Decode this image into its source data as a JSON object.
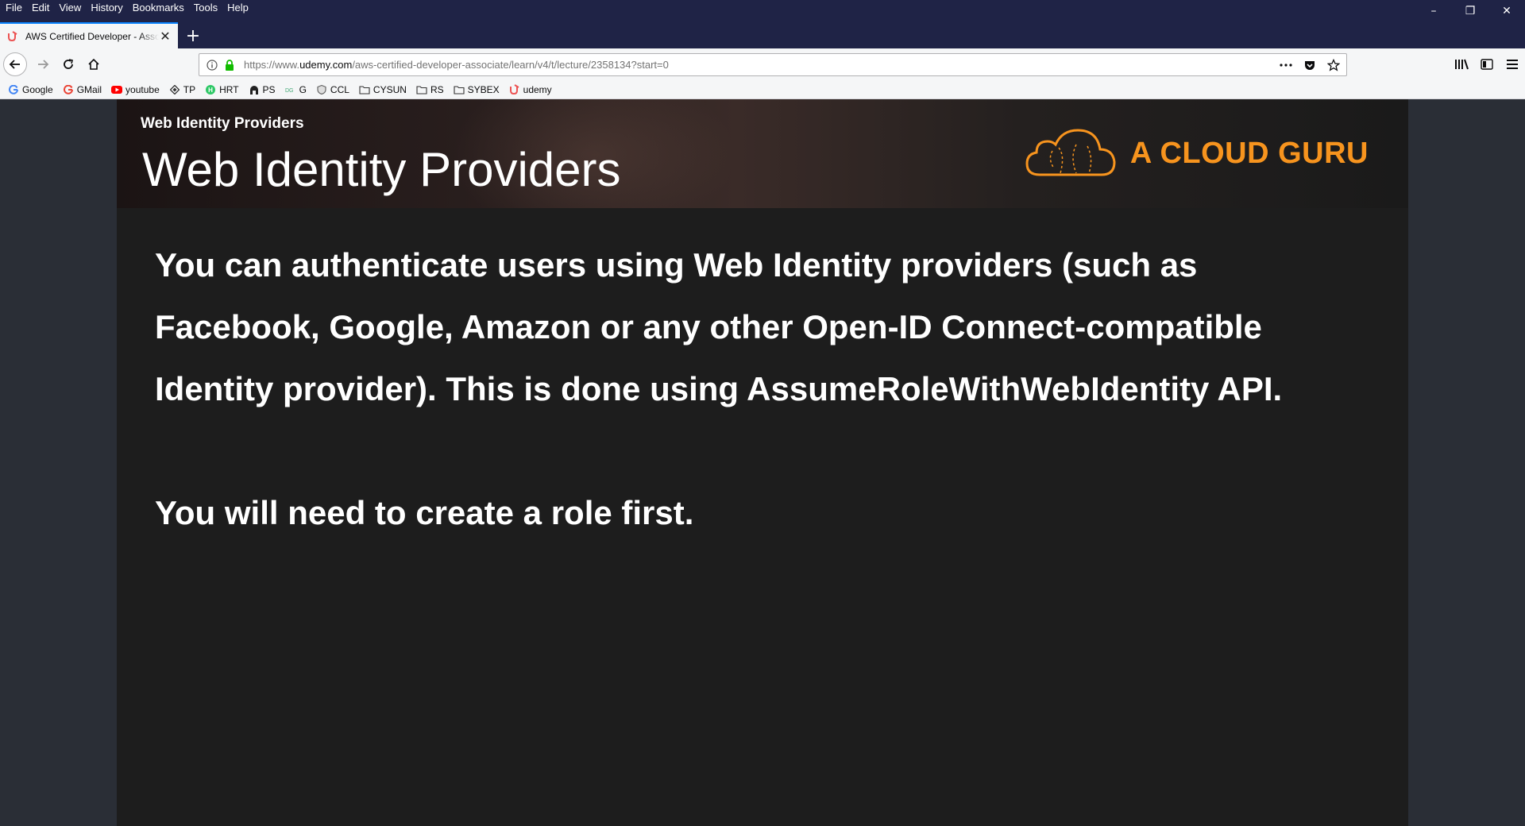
{
  "window": {
    "menu": [
      "File",
      "Edit",
      "View",
      "History",
      "Bookmarks",
      "Tools",
      "Help"
    ],
    "controls": {
      "minimize": "–",
      "restore": "❐",
      "close": "✕"
    }
  },
  "tab": {
    "title": "AWS Certified Developer - Associate",
    "close": "✕",
    "new_tab": "+"
  },
  "urlbar": {
    "prefix": "https://www.",
    "domain": "udemy.com",
    "path": "/aws-certified-developer-associate/learn/v4/t/lecture/2358134?start=0"
  },
  "bookmarks": [
    {
      "label": "Google",
      "icon": "google-icon"
    },
    {
      "label": "GMail",
      "icon": "google-icon"
    },
    {
      "label": "youtube",
      "icon": "youtube-icon"
    },
    {
      "label": "TP",
      "icon": "tp-icon"
    },
    {
      "label": "HRT",
      "icon": "hrt-icon"
    },
    {
      "label": "PS",
      "icon": "ps-icon"
    },
    {
      "label": "G",
      "icon": "g-icon"
    },
    {
      "label": "CCL",
      "icon": "shield-icon"
    },
    {
      "label": "CYSUN",
      "icon": "folder-icon"
    },
    {
      "label": "RS",
      "icon": "folder-icon"
    },
    {
      "label": "SYBEX",
      "icon": "folder-icon"
    },
    {
      "label": "udemy",
      "icon": "udemy-icon"
    }
  ],
  "slide": {
    "small_title": "Web Identity Providers",
    "title": "Web Identity Providers",
    "brand": "A CLOUD GURU",
    "paragraph1": "You can authenticate users using Web Identity providers (such as Facebook, Google, Amazon or any other Open-ID Connect-compatible Identity provider). This is done using AssumeRoleWithWebIdentity API.",
    "paragraph2": "You will need to create a role first."
  },
  "colors": {
    "titlebar": "#1f2346",
    "accent": "#0a84ff",
    "brand_orange": "#f7941e",
    "slide_bg": "#1d1d1d",
    "page_bg": "#2a2e36"
  }
}
